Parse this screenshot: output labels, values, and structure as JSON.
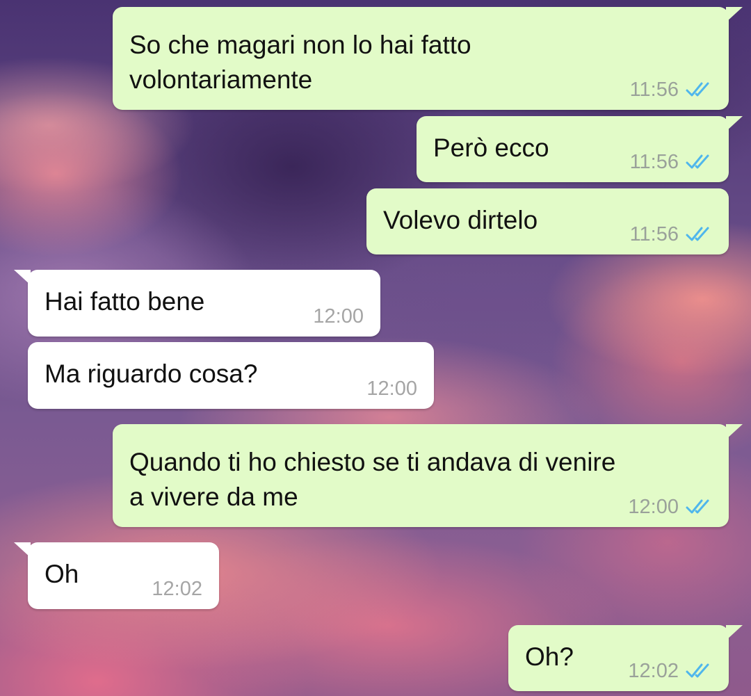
{
  "messages": [
    {
      "direction": "out",
      "lines": [
        "So che magari non lo hai fatto",
        "volontariamente"
      ],
      "time": "11:56",
      "status": "read"
    },
    {
      "direction": "out",
      "lines": [
        "Però ecco"
      ],
      "time": "11:56",
      "status": "read"
    },
    {
      "direction": "out",
      "lines": [
        "Volevo dirtelo"
      ],
      "time": "11:56",
      "status": "read"
    },
    {
      "direction": "in",
      "lines": [
        "Hai fatto bene"
      ],
      "time": "12:00"
    },
    {
      "direction": "in",
      "lines": [
        "Ma riguardo cosa?"
      ],
      "time": "12:00"
    },
    {
      "direction": "out",
      "lines": [
        "Quando ti ho chiesto se ti andava di venire",
        "a vivere da me"
      ],
      "time": "12:00",
      "status": "read"
    },
    {
      "direction": "in",
      "lines": [
        "Oh"
      ],
      "time": "12:02"
    },
    {
      "direction": "out",
      "lines": [
        "Oh?"
      ],
      "time": "12:02",
      "status": "read"
    }
  ],
  "colors": {
    "outgoing_bubble": "#e2fbc8",
    "incoming_bubble": "#ffffff",
    "read_ticks": "#4fb6ec",
    "timestamp": "#9aa19a"
  },
  "icons": {
    "read_receipt": "double-check-icon"
  }
}
